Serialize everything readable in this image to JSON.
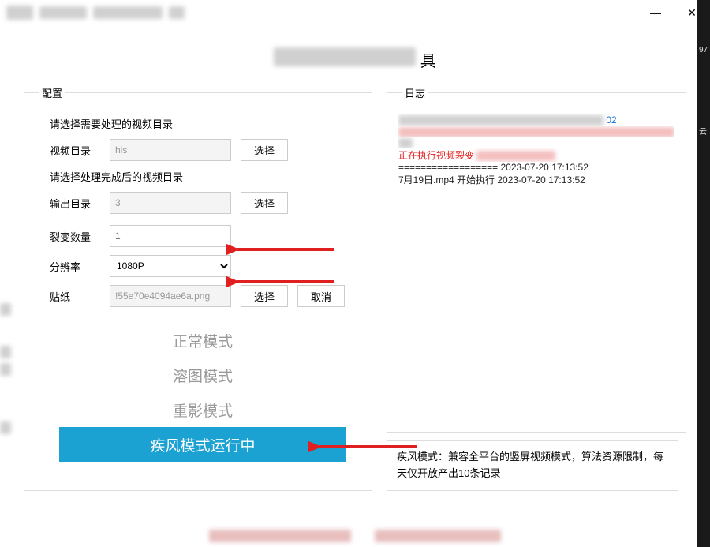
{
  "window": {
    "minimize": "—",
    "close": "✕"
  },
  "app_title_suffix": "具",
  "config": {
    "legend": "配置",
    "note_source": "请选择需要处理的视频目录",
    "label_video_dir": "视频目录",
    "value_video_dir": "his",
    "btn_select": "选择",
    "note_output": "请选择处理完成后的视频目录",
    "label_output_dir": "输出目录",
    "value_output_dir": "3",
    "label_split_count": "裂变数量",
    "value_split_count": "1",
    "label_resolution": "分辨率",
    "value_resolution": "1080P",
    "label_sticker": "贴纸",
    "value_sticker": "!55e70e4094ae6a.png",
    "btn_cancel": "取消"
  },
  "modes": {
    "normal": "正常模式",
    "dissolve": "溶图模式",
    "ghost": "重影模式",
    "fast_running": "疾风模式运行中"
  },
  "log": {
    "legend": "日志",
    "line1_suffix": "02",
    "line2_prefix": "正在执行视频裂变",
    "line3": "================== 2023-07-20 17:13:52",
    "line4": "7月19日.mp4 开始执行 2023-07-20 17:13:52"
  },
  "hint": "疾风模式：兼容全平台的竖屏视频模式，算法资源限制，每天仅开放产出10条记录"
}
